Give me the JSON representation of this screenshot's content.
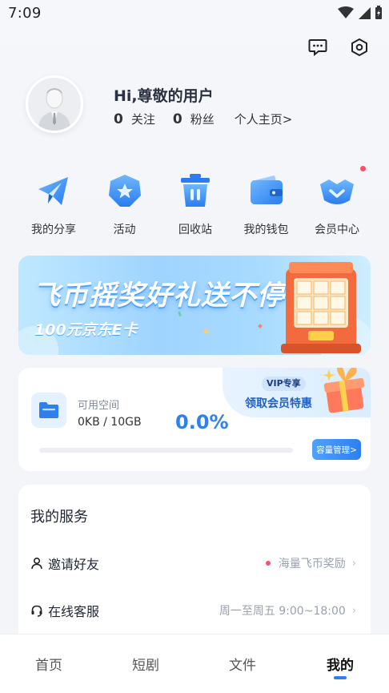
{
  "status_bar": {
    "time": "7:09"
  },
  "profile": {
    "greeting": "Hi,尊敬的用户",
    "following_count": "0",
    "following_label": "关注",
    "followers_count": "0",
    "followers_label": "粉丝",
    "homepage_link": "个人主页>"
  },
  "quick_menu": [
    {
      "label": "我的分享",
      "icon": "paper-plane-icon"
    },
    {
      "label": "活动",
      "icon": "star-badge-icon"
    },
    {
      "label": "回收站",
      "icon": "trash-icon"
    },
    {
      "label": "我的钱包",
      "icon": "wallet-icon"
    },
    {
      "label": "会员中心",
      "icon": "crown-icon"
    }
  ],
  "banner": {
    "title": "飞币摇奖好礼送不停",
    "subtitle": "100元京东E卡"
  },
  "storage": {
    "label": "可用空间",
    "usage": "0KB / 10GB",
    "percent": "0.0%",
    "percent_value": 0,
    "vip_badge": "VIP专享",
    "vip_text": "领取会员特惠",
    "manage_button": "容量管理>"
  },
  "services": {
    "title": "我的服务",
    "items": [
      {
        "label": "邀请好友",
        "detail": "海量飞币奖励",
        "icon": "user-icon"
      },
      {
        "label": "在线客服",
        "detail": "周一至周五 9:00~18:00",
        "icon": "headset-icon"
      }
    ]
  },
  "tabbar": {
    "tabs": [
      "首页",
      "短剧",
      "文件",
      "我的"
    ],
    "active": "我的"
  },
  "colors": {
    "accent": "#2f80ed",
    "alert": "#ff4d6a"
  }
}
